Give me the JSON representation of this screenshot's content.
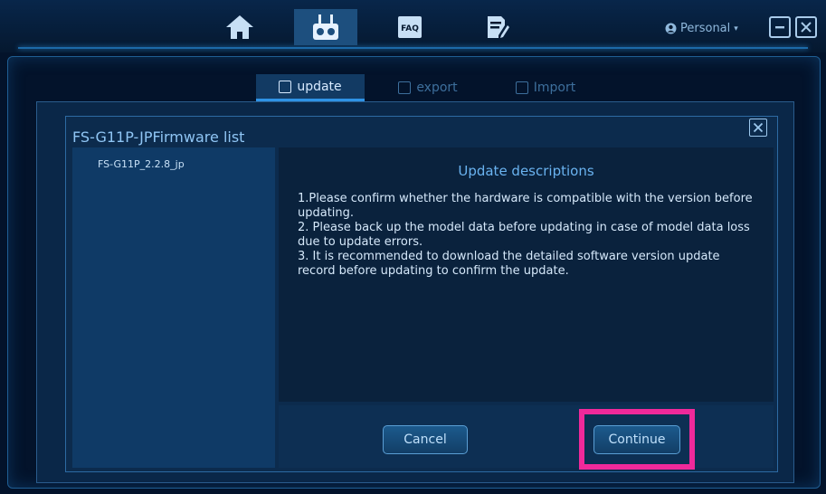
{
  "nav": {
    "icons": [
      "home-icon",
      "remote-controller-icon",
      "faq-icon",
      "document-edit-icon"
    ],
    "faq_label": "FAQ",
    "user_label": "Personal"
  },
  "tabs": [
    {
      "label": "update",
      "icon": "update-icon",
      "active": true
    },
    {
      "label": "export",
      "icon": "export-icon",
      "active": false
    },
    {
      "label": "Import",
      "icon": "import-icon",
      "active": false
    }
  ],
  "modal": {
    "title": "FS-G11P-JPFirmware list",
    "firmware_items": [
      "FS-G11P_2.2.8_jp"
    ],
    "description_title": "Update descriptions",
    "description_lines": [
      "1.Please confirm whether the hardware is compatible with the version before updating.",
      "2. Please back up the model data before updating in case of model data loss due to update errors.",
      "3. It is recommended to download the detailed software version update record before updating to confirm the update."
    ],
    "cancel_label": "Cancel",
    "continue_label": "Continue"
  },
  "colors": {
    "background": "#03132b",
    "accent": "#2f93e6",
    "highlight": "#f0299a"
  }
}
